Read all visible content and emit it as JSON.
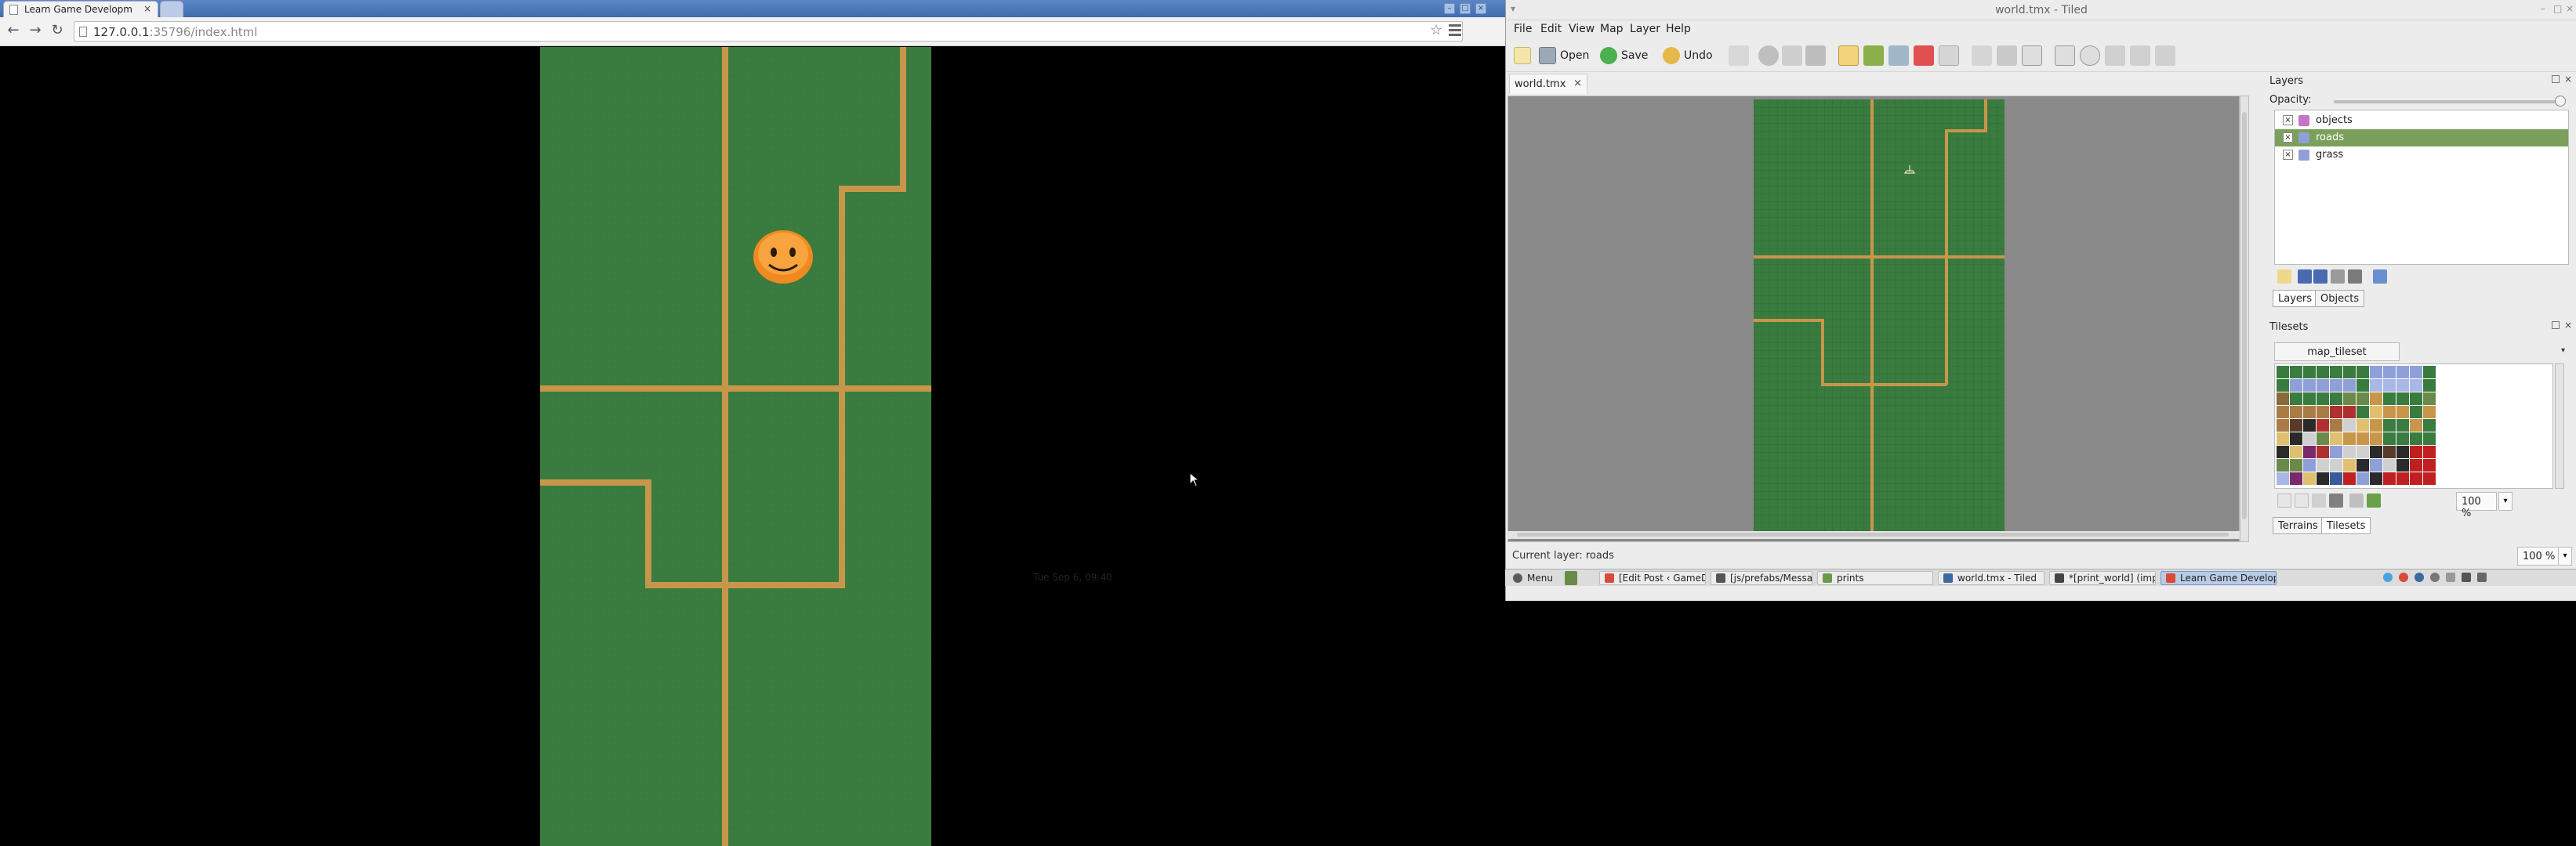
{
  "browser": {
    "tab_title": "Learn Game Developm",
    "tab_close": "×",
    "url_host": "127.0.0.1",
    "url_rest": ":35796/index.html"
  },
  "tiled": {
    "window_title": "world.tmx - Tiled",
    "menu": [
      "File",
      "Edit",
      "View",
      "Map",
      "Layer",
      "Help"
    ],
    "toolbar": {
      "open": "Open",
      "save": "Save",
      "undo": "Undo"
    },
    "doc_tab": "world.tmx",
    "doc_tab_close": "×",
    "status": "Current layer: roads",
    "zoom": "100 %",
    "layers_panel": {
      "title": "Layers",
      "opacity_label": "Opacity:",
      "layers": [
        {
          "name": "objects",
          "visible": true,
          "selected": false,
          "icon_color": "#c673c8"
        },
        {
          "name": "roads",
          "visible": true,
          "selected": true,
          "icon_color": "#8fa0d8"
        },
        {
          "name": "grass",
          "visible": true,
          "selected": false,
          "icon_color": "#8fa0d8"
        }
      ],
      "tabs": [
        "Layers",
        "Objects"
      ]
    },
    "tilesets_panel": {
      "title": "Tilesets",
      "tileset_name": "map_tileset",
      "zoom": "100 %",
      "tabs": [
        "Terrains",
        "Tilesets"
      ]
    }
  },
  "taskbar": {
    "menu": "Menu",
    "tasks": [
      {
        "label": "[Edit Post ‹ GameDe...",
        "icon_color": "#d94a38",
        "active": false
      },
      {
        "label": "[js/prefabs/Message...",
        "icon_color": "#555555",
        "active": false
      },
      {
        "label": "prints",
        "icon_color": "#6a9a4a",
        "active": false
      },
      {
        "label": "world.tmx - Tiled",
        "icon_color": "#3b6aa0",
        "active": false
      },
      {
        "label": "*[print_world] (impor...",
        "icon_color": "#444444",
        "active": false
      },
      {
        "label": "Learn Game Develop...",
        "icon_color": "#d94a38",
        "active": true
      }
    ],
    "clock": "Tue Sep 6, 09:40"
  },
  "colors": {
    "grass": "#3a7b40",
    "road": "#c8964a",
    "selection": "#7ba05b",
    "browser_titlebar": "#4a78bc",
    "character": "#f5a23a"
  }
}
